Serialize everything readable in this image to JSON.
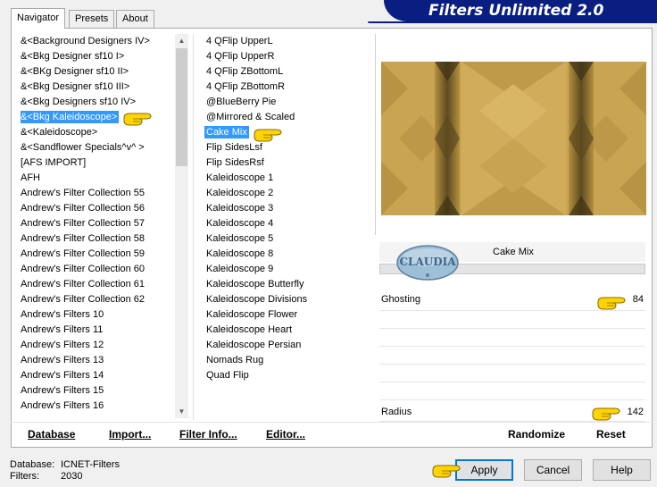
{
  "tabs": [
    {
      "label": "Navigator",
      "active": true
    },
    {
      "label": "Presets",
      "active": false
    },
    {
      "label": "About",
      "active": false
    }
  ],
  "title": "Filters Unlimited 2.0",
  "categories": {
    "items": [
      "&<Background Designers IV>",
      "&<Bkg Designer sf10 I>",
      "&<BKg Designer sf10 II>",
      "&<Bkg Designer sf10 III>",
      "&<Bkg Designers sf10 IV>",
      "&<Bkg Kaleidoscope>",
      "&<Kaleidoscope>",
      "&<Sandflower Specials^v^ >",
      "[AFS IMPORT]",
      "AFH",
      "Andrew's Filter Collection 55",
      "Andrew's Filter Collection 56",
      "Andrew's Filter Collection 57",
      "Andrew's Filter Collection 58",
      "Andrew's Filter Collection 59",
      "Andrew's Filter Collection 60",
      "Andrew's Filter Collection 61",
      "Andrew's Filter Collection 62",
      "Andrew's Filters 10",
      "Andrew's Filters 11",
      "Andrew's Filters 12",
      "Andrew's Filters 13",
      "Andrew's Filters 14",
      "Andrew's Filters 15",
      "Andrew's Filters 16"
    ],
    "selected_index": 5
  },
  "filters": {
    "items": [
      "4 QFlip UpperL",
      "4 QFlip UpperR",
      "4 QFlip ZBottomL",
      "4 QFlip ZBottomR",
      "@BlueBerry Pie",
      "@Mirrored & Scaled",
      "Cake Mix",
      "Flip SidesLsf",
      "Flip SidesRsf",
      "Kaleidoscope 1",
      "Kaleidoscope 2",
      "Kaleidoscope 3",
      "Kaleidoscope 4",
      "Kaleidoscope 5",
      "Kaleidoscope 8",
      "Kaleidoscope 9",
      "Kaleidoscope Butterfly",
      "Kaleidoscope Divisions",
      "Kaleidoscope Flower",
      "Kaleidoscope Heart",
      "Kaleidoscope Persian",
      "Nomads Rug",
      "Quad Flip"
    ],
    "selected_index": 6
  },
  "current_filter": "Cake Mix",
  "watermark": "CLAUDIA",
  "params": [
    {
      "label": "Ghosting",
      "value": "84"
    },
    {
      "label": "Radius",
      "value": "142"
    }
  ],
  "left_buttons": {
    "database": "Database",
    "import": "Import...",
    "filter_info": "Filter Info...",
    "editor": "Editor..."
  },
  "right_buttons": {
    "randomize": "Randomize",
    "reset": "Reset"
  },
  "footer": {
    "database_label": "Database:",
    "database_value": "ICNET-Filters",
    "filters_label": "Filters:",
    "filters_value": "2030"
  },
  "dialog_buttons": {
    "apply": "Apply",
    "cancel": "Cancel",
    "help": "Help"
  },
  "colors": {
    "banner": "#0a1e82",
    "selection": "#3399ff",
    "preview_gold": "#c9a552",
    "hand": "#ffd400"
  }
}
